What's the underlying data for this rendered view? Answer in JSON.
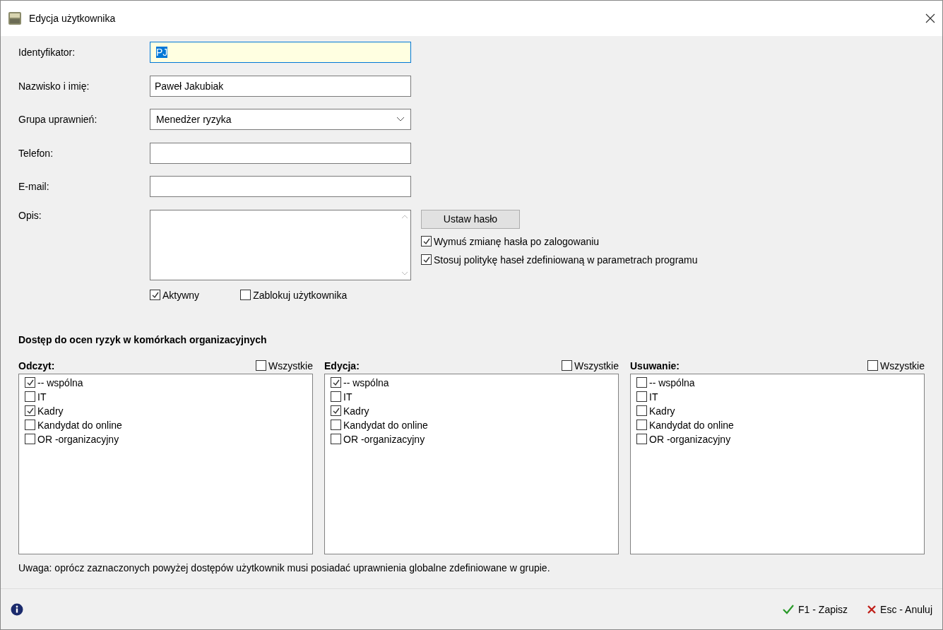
{
  "window": {
    "title": "Edycja użytkownika"
  },
  "fields": [
    {
      "label": "Identyfikator:",
      "kind": "text",
      "value": "PJ",
      "focused": true
    },
    {
      "label": "Nazwisko i imię:",
      "kind": "text",
      "value": "Paweł Jakubiak",
      "focused": false
    },
    {
      "label": "Grupa uprawnień:",
      "kind": "select",
      "value": "Menedżer ryzyka",
      "focused": false
    },
    {
      "label": "Telefon:",
      "kind": "text",
      "focused": false
    },
    {
      "label": "E-mail:",
      "kind": "text",
      "focused": false
    }
  ],
  "description": {
    "label": "Opis:"
  },
  "set_password_button": "Ustaw hasło",
  "password_options": [
    {
      "label": "Wymuś zmianę hasła po zalogowaniu",
      "checked": true
    },
    {
      "label": "Stosuj politykę haseł zdefiniowaną w parametrach programu",
      "checked": true
    }
  ],
  "status_options": [
    {
      "label": "Aktywny",
      "checked": true
    },
    {
      "label": "Zablokuj użytkownika",
      "checked": false
    }
  ],
  "access": {
    "title": "Dostęp do ocen ryzyk w komórkach organizacyjnych",
    "columns": [
      {
        "title": "Odczyt:",
        "all_label": "Wszystkie",
        "all_checked": false,
        "items": [
          {
            "label": " -- wspólna",
            "checked": true
          },
          {
            "label": "IT",
            "checked": false
          },
          {
            "label": "Kadry",
            "checked": true
          },
          {
            "label": "Kandydat do online",
            "checked": false
          },
          {
            "label": "OR -organizacyjny",
            "checked": false
          }
        ]
      },
      {
        "title": "Edycja:",
        "all_label": "Wszystkie",
        "all_checked": false,
        "items": [
          {
            "label": " -- wspólna",
            "checked": true
          },
          {
            "label": "IT",
            "checked": false
          },
          {
            "label": "Kadry",
            "checked": true
          },
          {
            "label": "Kandydat do online",
            "checked": false
          },
          {
            "label": "OR -organizacyjny",
            "checked": false
          }
        ]
      },
      {
        "title": "Usuwanie:",
        "all_label": "Wszystkie",
        "all_checked": false,
        "items": [
          {
            "label": " -- wspólna",
            "checked": false
          },
          {
            "label": "IT",
            "checked": false
          },
          {
            "label": "Kadry",
            "checked": false
          },
          {
            "label": "Kandydat do online",
            "checked": false
          },
          {
            "label": "OR -organizacyjny",
            "checked": false
          }
        ]
      }
    ],
    "note": "Uwaga: oprócz zaznaczonych powyżej dostępów użytkownik musi posiadać uprawnienia globalne zdefiniowane w grupie."
  },
  "footer": {
    "save": "F1 - Zapisz",
    "cancel": "Esc - Anuluj"
  }
}
